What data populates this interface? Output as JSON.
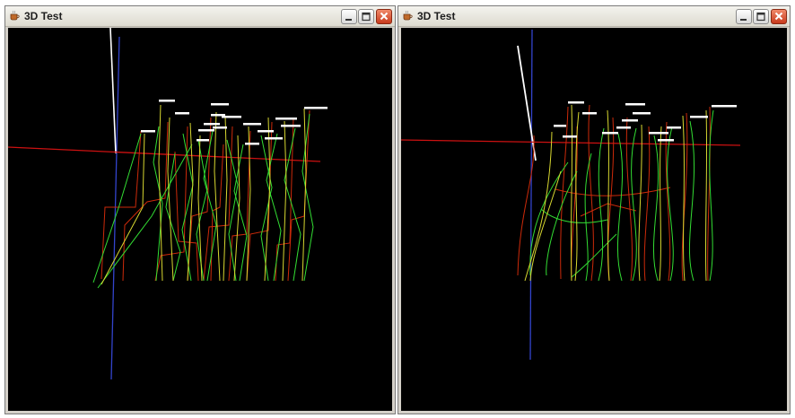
{
  "windows": [
    {
      "title": "3D Test",
      "icon": "coffee-cup-icon"
    },
    {
      "title": "3D Test",
      "icon": "coffee-cup-icon"
    }
  ],
  "window_controls": [
    "minimize-icon",
    "maximize-icon",
    "close-icon"
  ],
  "colors": {
    "canvas_bg": "#000000",
    "x_axis": "#cc1111",
    "y_axis": "#3344cc",
    "z_axis": "#ffffff",
    "trace_red": "#cc2a0a",
    "trace_green": "#33dd33",
    "trace_yellow": "#d8d830"
  }
}
